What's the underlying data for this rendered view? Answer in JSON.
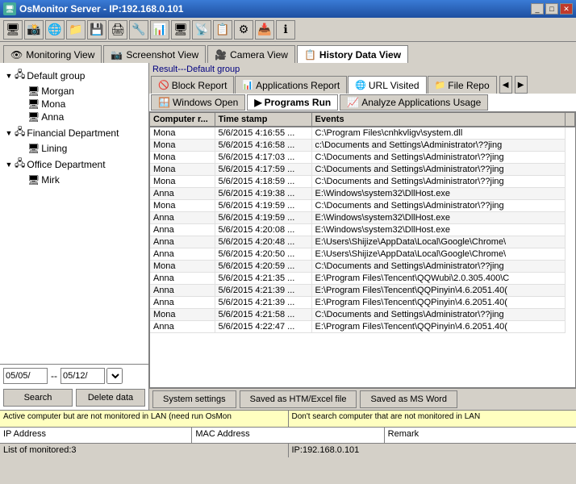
{
  "titlebar": {
    "title": "OsMonitor Server - IP:192.168.0.101",
    "icon": "🖥"
  },
  "tabs": [
    {
      "id": "monitoring",
      "label": "Monitoring View",
      "icon": "👁"
    },
    {
      "id": "screenshot",
      "label": "Screenshot View",
      "icon": "📷"
    },
    {
      "id": "camera",
      "label": "Camera View",
      "icon": "🎥"
    },
    {
      "id": "history",
      "label": "History Data View",
      "icon": "📋",
      "active": true
    }
  ],
  "tree": {
    "items": [
      {
        "level": 0,
        "expanded": true,
        "type": "group",
        "label": "Default group",
        "icon": "🖧"
      },
      {
        "level": 1,
        "expanded": false,
        "type": "computer",
        "label": "Morgan",
        "icon": "🖥"
      },
      {
        "level": 1,
        "expanded": false,
        "type": "computer",
        "label": "Mona",
        "icon": "🖥"
      },
      {
        "level": 1,
        "expanded": false,
        "type": "computer",
        "label": "Anna",
        "icon": "🖥"
      },
      {
        "level": 0,
        "expanded": true,
        "type": "group",
        "label": "Financial Department",
        "icon": "🖧"
      },
      {
        "level": 1,
        "expanded": false,
        "type": "computer",
        "label": "Lining",
        "icon": "🖥"
      },
      {
        "level": 0,
        "expanded": true,
        "type": "group",
        "label": "Office Department",
        "icon": "🖧"
      },
      {
        "level": 1,
        "expanded": false,
        "type": "computer",
        "label": "Mirk",
        "icon": "🖥"
      }
    ]
  },
  "date_range": {
    "start": "05/05/",
    "end": "05/12/",
    "dash": "--"
  },
  "buttons": {
    "search": "Search",
    "delete": "Delete data",
    "system_settings": "System settings",
    "save_htm": "Saved as HTM/Excel file",
    "save_word": "Saved as MS Word"
  },
  "result_label": "Result---Default group",
  "report_tabs": [
    {
      "id": "block",
      "label": "Block Report",
      "icon": "🚫",
      "active": false
    },
    {
      "id": "applications",
      "label": "Applications Report",
      "icon": "📊",
      "active": false
    },
    {
      "id": "url",
      "label": "URL Visited",
      "icon": "🌐",
      "active": true
    },
    {
      "id": "filerep",
      "label": "File Repo",
      "icon": "📁",
      "active": false
    }
  ],
  "sub_tabs": [
    {
      "id": "windows_open",
      "label": "Windows Open",
      "icon": "🪟",
      "active": false
    },
    {
      "id": "programs_run",
      "label": "Programs Run",
      "icon": "▶",
      "active": true
    },
    {
      "id": "analyze",
      "label": "Analyze Applications Usage",
      "icon": "📈",
      "active": false
    }
  ],
  "table": {
    "columns": [
      "Computer r...",
      "Time stamp",
      "Events"
    ],
    "rows": [
      {
        "computer": "Mona",
        "timestamp": "5/6/2015 4:16:55 ...",
        "event": "C:\\Program Files\\cnhkvligv\\system.dll"
      },
      {
        "computer": "Mona",
        "timestamp": "5/6/2015 4:16:58 ...",
        "event": "c:\\Documents and Settings\\Administrator\\??jing"
      },
      {
        "computer": "Mona",
        "timestamp": "5/6/2015 4:17:03 ...",
        "event": "C:\\Documents and Settings\\Administrator\\??jing"
      },
      {
        "computer": "Mona",
        "timestamp": "5/6/2015 4:17:59 ...",
        "event": "C:\\Documents and Settings\\Administrator\\??jing"
      },
      {
        "computer": "Mona",
        "timestamp": "5/6/2015 4:18:59 ...",
        "event": "C:\\Documents and Settings\\Administrator\\??jing"
      },
      {
        "computer": "Anna",
        "timestamp": "5/6/2015 4:19:38 ...",
        "event": "E:\\Windows\\system32\\DllHost.exe"
      },
      {
        "computer": "Mona",
        "timestamp": "5/6/2015 4:19:59 ...",
        "event": "C:\\Documents and Settings\\Administrator\\??jing"
      },
      {
        "computer": "Anna",
        "timestamp": "5/6/2015 4:19:59 ...",
        "event": "E:\\Windows\\system32\\DllHost.exe"
      },
      {
        "computer": "Anna",
        "timestamp": "5/6/2015 4:20:08 ...",
        "event": "E:\\Windows\\system32\\DllHost.exe"
      },
      {
        "computer": "Anna",
        "timestamp": "5/6/2015 4:20:48 ...",
        "event": "E:\\Users\\Shijize\\AppData\\Local\\Google\\Chrome\\"
      },
      {
        "computer": "Anna",
        "timestamp": "5/6/2015 4:20:50 ...",
        "event": "E:\\Users\\Shijize\\AppData\\Local\\Google\\Chrome\\"
      },
      {
        "computer": "Mona",
        "timestamp": "5/6/2015 4:20:59 ...",
        "event": "C:\\Documents and Settings\\Administrator\\??jing"
      },
      {
        "computer": "Anna",
        "timestamp": "5/6/2015 4:21:35 ...",
        "event": "E:\\Program Files\\Tencent\\QQWubi\\2.0.305.400\\C"
      },
      {
        "computer": "Anna",
        "timestamp": "5/6/2015 4:21:39 ...",
        "event": "E:\\Program Files\\Tencent\\QQPinyin\\4.6.2051.40("
      },
      {
        "computer": "Anna",
        "timestamp": "5/6/2015 4:21:39 ...",
        "event": "E:\\Program Files\\Tencent\\QQPinyin\\4.6.2051.40("
      },
      {
        "computer": "Mona",
        "timestamp": "5/6/2015 4:21:58 ...",
        "event": "C:\\Documents and Settings\\Administrator\\??jing"
      },
      {
        "computer": "Anna",
        "timestamp": "5/6/2015 4:22:47 ...",
        "event": "E:\\Program Files\\Tencent\\QQPinyin\\4.6.2051.40("
      }
    ]
  },
  "status": {
    "notice_left": "Active computer but are not monitored in LAN (need run OsMon",
    "notice_right": "Don't search computer that are not monitored in LAN",
    "col1": "IP Address",
    "col2": "MAC Address",
    "col3": "Remark",
    "monitored": "List of monitored:3",
    "ip": "IP:192.168.0.101"
  }
}
